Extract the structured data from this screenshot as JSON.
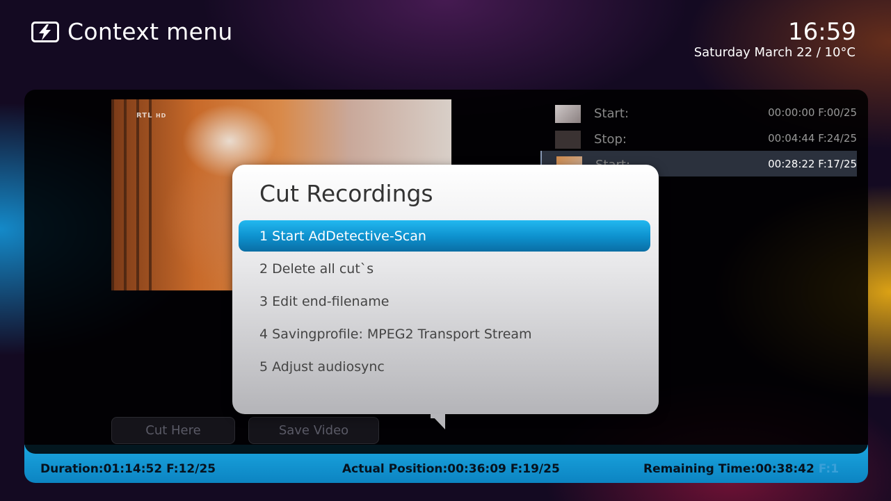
{
  "header": {
    "title": "Context menu",
    "icon": "cut-lightning-icon",
    "time": "16:59",
    "date_weather": "Saturday March 22 / 10°C"
  },
  "video": {
    "channel_logo": "RTL",
    "channel_logo_suffix": "HD"
  },
  "marks": [
    {
      "label": "Start:",
      "time": "00:00:00 F:00/25",
      "selected": false
    },
    {
      "label": "Stop:",
      "time": "00:04:44 F:24/25",
      "selected": false
    },
    {
      "label": "Start:",
      "time": "00:28:22 F:17/25",
      "selected": true
    }
  ],
  "buttons": {
    "cut_here": "Cut Here",
    "save_video": "Save Video"
  },
  "status": {
    "duration": "Duration:01:14:52 F:12/25",
    "actual_position": "Actual Position:00:36:09 F:19/25",
    "remaining": "Remaining Time:00:38:42",
    "remaining_cut": "F:1"
  },
  "popup": {
    "title": "Cut Recordings",
    "items": [
      "1 Start AdDetective-Scan",
      "2 Delete all cut`s",
      "3 Edit end-filename",
      "4 Savingprofile: MPEG2 Transport Stream",
      "5 Adjust audiosync"
    ],
    "selected_index": 0
  },
  "colors": {
    "accent": "#1ba6e0",
    "highlight": "#0d8fcc"
  }
}
